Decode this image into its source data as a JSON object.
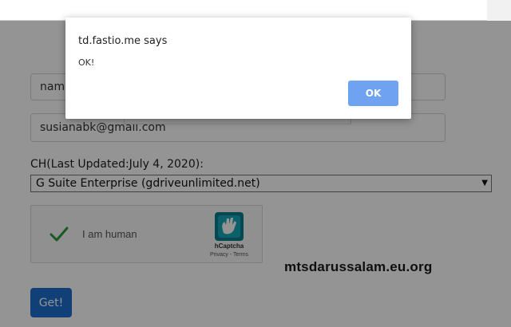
{
  "form": {
    "name_value": "nam",
    "email_value": "susianabk@gmail.com",
    "ch_label": "CH(Last Updated:July 4, 2020):",
    "select_value": "G Suite Enterprise (gdriveunlimited.net)",
    "get_label": "Get!"
  },
  "captcha": {
    "checkbox_label": "I am human",
    "brand": "hCaptcha",
    "links": "Privacy - Terms",
    "checked": true
  },
  "watermark": "mtsdarussalam.eu.org",
  "dialog": {
    "title": "td.fastio.me says",
    "message": "OK!",
    "ok_label": "OK"
  },
  "colors": {
    "button_primary": "#1e6fd0",
    "dialog_ok": "#6fa2f1",
    "check": "#2e9a3a"
  },
  "icons": [
    "checkmark-icon",
    "hcaptcha-logo-icon",
    "select-arrow-icon"
  ]
}
